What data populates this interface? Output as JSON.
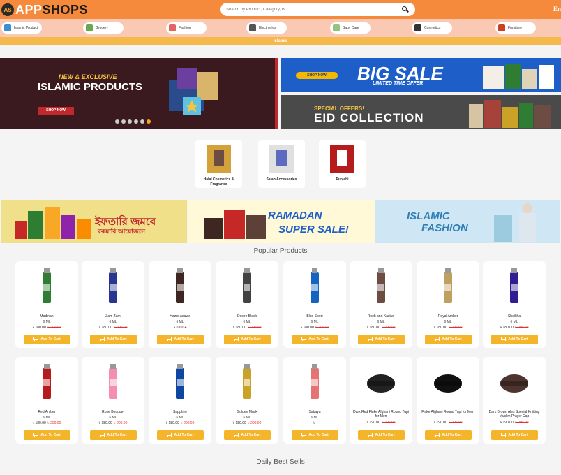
{
  "header": {
    "logo_mark": "AS",
    "logo_text_a": "APP",
    "logo_text_b": "SHOPS",
    "search_placeholder": "Search by Product, Category, Br",
    "lang": "En"
  },
  "categories": [
    {
      "label": "Islamic Product",
      "color": "#3d8fd1"
    },
    {
      "label": "Grocery",
      "color": "#6aa84f"
    },
    {
      "label": "Fashion",
      "color": "#e06666"
    },
    {
      "label": "Electronics",
      "color": "#555555"
    },
    {
      "label": "Baby Care",
      "color": "#93c47d"
    },
    {
      "label": "Cosmetics",
      "color": "#333333"
    },
    {
      "label": "Furniture",
      "color": "#cc4125"
    }
  ],
  "info_bar": "Islamic",
  "banners": {
    "main_new": "NEW & EXCLUSIVE",
    "main_title": "ISLAMIC PRODUCTS",
    "main_btn": "SHOP NOW",
    "big_shop": "SHOP NOW",
    "big_title": "BIG SALE",
    "big_sub": "LIMITED TIME OFFER",
    "eid_special": "SPECIAL OFFERS!",
    "eid_title": "EID COLLECTION",
    "dot_count": 6,
    "active_dot": 5
  },
  "subcategories": [
    {
      "label": "Halal Cosmetics & Fragrance"
    },
    {
      "label": "Salah Accessories"
    },
    {
      "label": "Punjabi"
    }
  ],
  "promos": {
    "p1_line1": "ইফতারি জমবে",
    "p1_line2": "রকমারি আয়োজনে",
    "p2_line1": "RAMADAN",
    "p2_line2": "SUPER SALE!",
    "p3_line1": "ISLAMIC",
    "p3_line2": "FASHION"
  },
  "popular_title": "Popular Products",
  "daily_title": "Daily Best Sells",
  "add_to_cart": "Add To Cart",
  "products_row1": [
    {
      "name": "Madinah",
      "size": "6 ML",
      "price": "৳ 180.00",
      "old": "৳ 200.00",
      "color": "#2e7d32"
    },
    {
      "name": "Zam Zam",
      "size": "6 ML",
      "price": "৳ 180.00",
      "old": "৳ 200.00",
      "color": "#283593"
    },
    {
      "name": "Hazre Asawa",
      "size": "6 ML",
      "price": "৳ 0.00",
      "old": "৳",
      "color": "#3e2723"
    },
    {
      "name": "Desire Black",
      "size": "6 ML",
      "price": "৳ 180.00",
      "old": "৳ 200.00",
      "color": "#424242"
    },
    {
      "name": "Blue Sport",
      "size": "6 ML",
      "price": "৳ 180.00",
      "old": "৳ 200.00",
      "color": "#1565c0"
    },
    {
      "name": "Rooh and Kasturi",
      "size": "6 ML",
      "price": "৳ 180.00",
      "old": "৳ 200.00",
      "color": "#6d4c41"
    },
    {
      "name": "Royal Amber",
      "size": "6 ML",
      "price": "৳ 180.00",
      "old": "৳ 200.00",
      "color": "#c0a060"
    },
    {
      "name": "Sheikha",
      "size": "6 ML",
      "price": "৳ 180.00",
      "old": "৳ 200.00",
      "color": "#311b92"
    }
  ],
  "products_row2": [
    {
      "name": "Red Amber",
      "size": "6 ML",
      "price": "৳ 180.00",
      "old": "৳ 200.00",
      "color": "#b71c1c"
    },
    {
      "name": "Rose Bouquet",
      "size": "6 ML",
      "price": "৳ 180.00",
      "old": "৳ 200.00",
      "color": "#f48fb1"
    },
    {
      "name": "Sapphire",
      "size": "6 ML",
      "price": "৳ 180.00",
      "old": "৳ 200.00",
      "color": "#0d47a1"
    },
    {
      "name": "Golden Musk",
      "size": "6 ML",
      "price": "৳ 180.00",
      "old": "৳ 200.00",
      "color": "#c9a227"
    },
    {
      "name": "Sabaya",
      "size": "6 ML",
      "price": "৳",
      "old": "",
      "color": "#e57373"
    },
    {
      "name": "Dark Red Flake Afghani Round Tupi for Men",
      "size": "",
      "price": "৳ 190.00",
      "old": "৳ 200.00",
      "color": "#222222"
    },
    {
      "name": "Flake Afghani Round Tupi for Men",
      "size": "",
      "price": "৳ 190.00",
      "old": "৳ 200.00",
      "color": "#111111"
    },
    {
      "name": "Dark Brown Ales Special Knitting Muslim Prayer Cap",
      "size": "",
      "price": "৳ 190.00",
      "old": "৳ 200.00",
      "color": "#4e342e"
    }
  ]
}
